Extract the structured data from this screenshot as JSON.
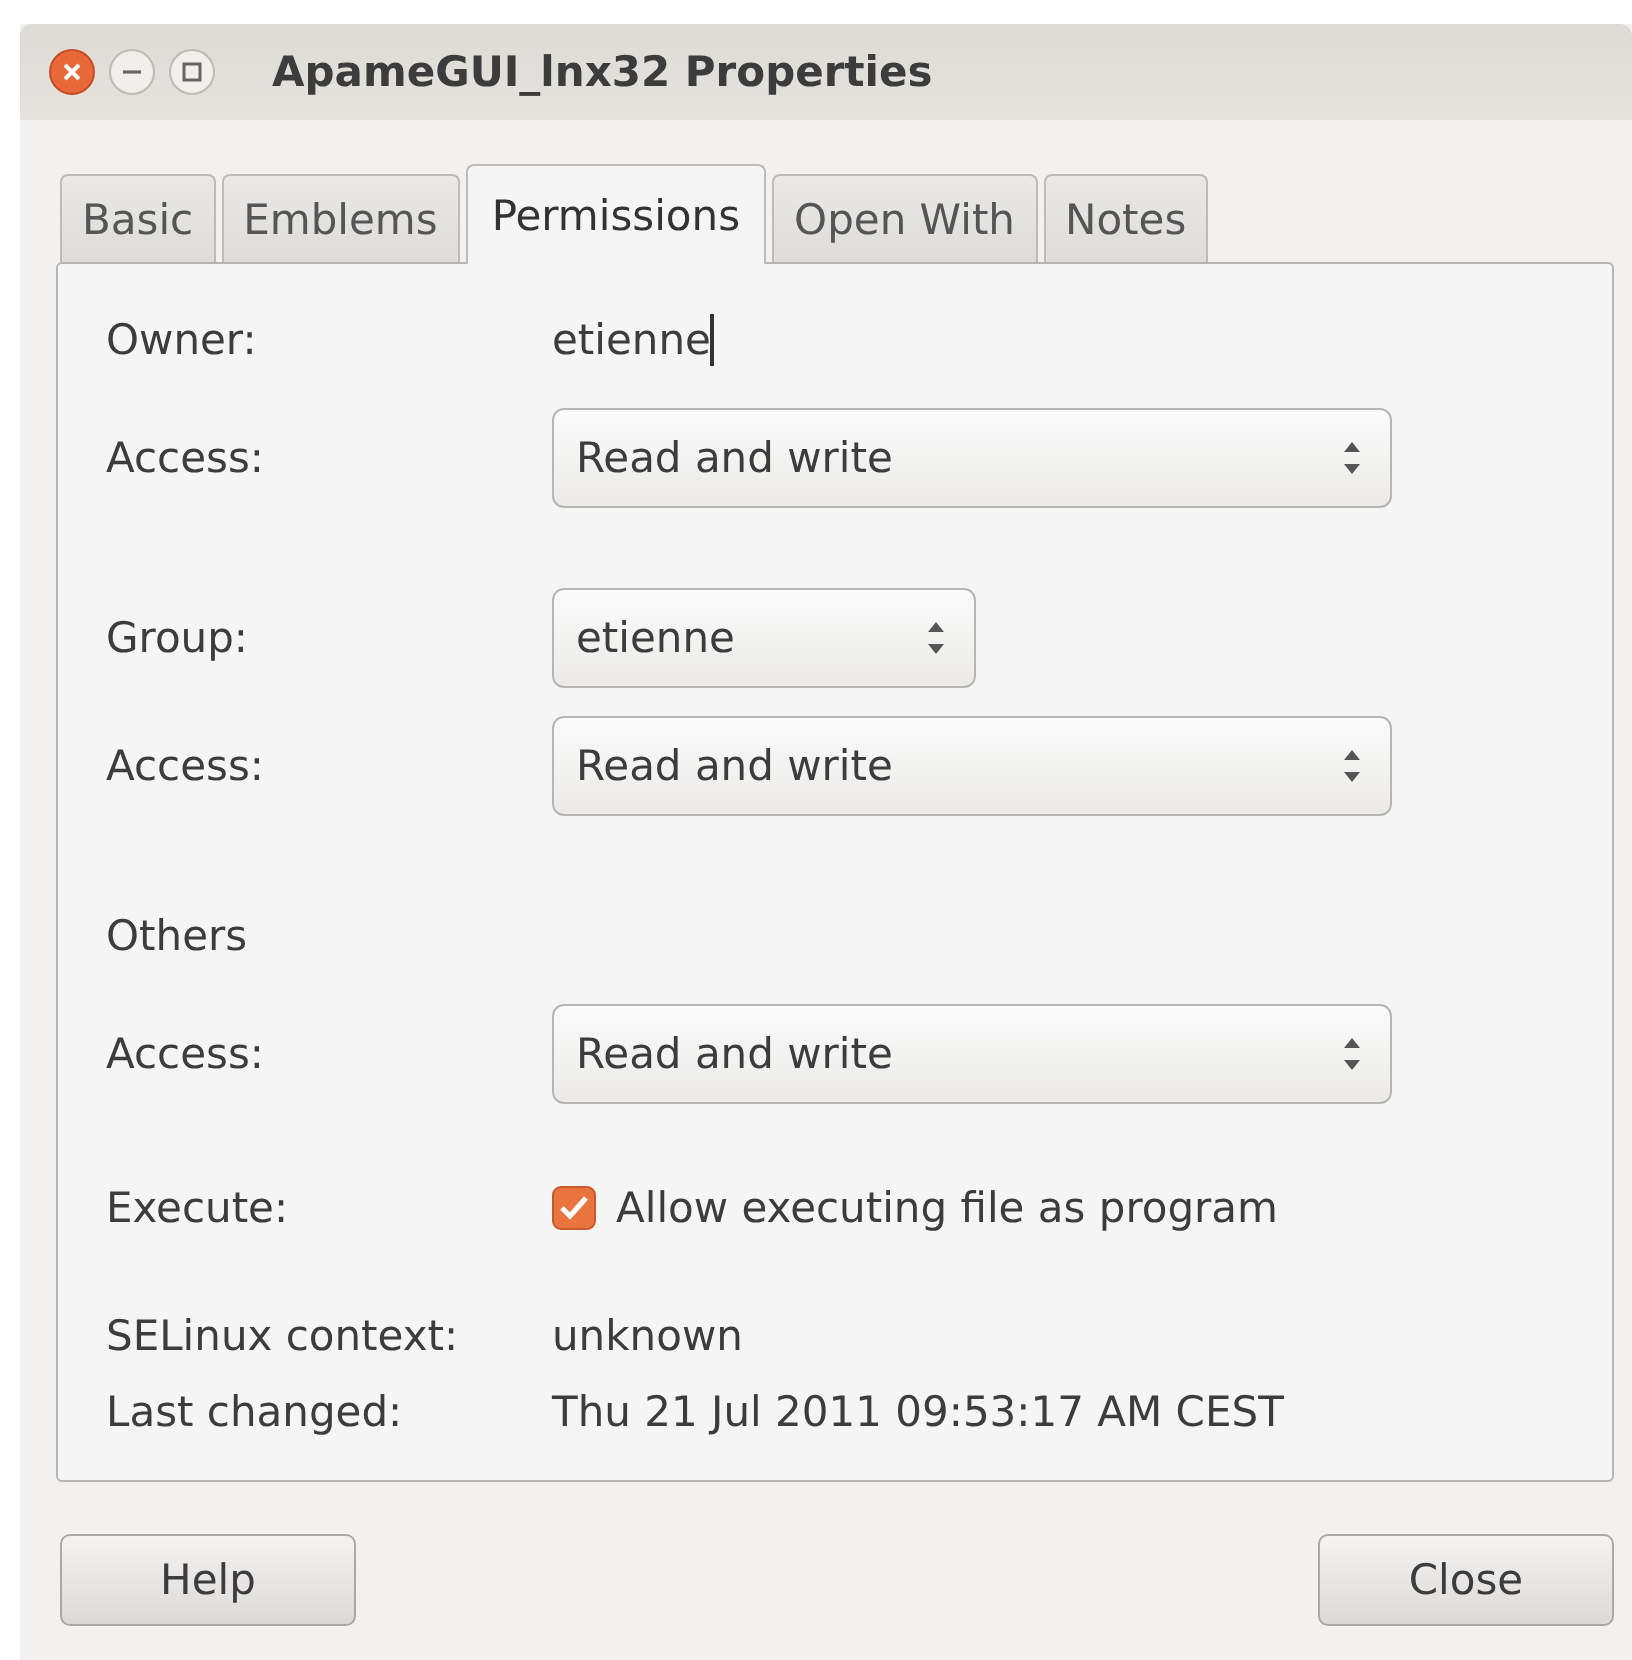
{
  "window": {
    "title": "ApameGUI_lnx32 Properties"
  },
  "tabs": [
    {
      "label": "Basic",
      "selected": false
    },
    {
      "label": "Emblems",
      "selected": false
    },
    {
      "label": "Permissions",
      "selected": true
    },
    {
      "label": "Open With",
      "selected": false
    },
    {
      "label": "Notes",
      "selected": false
    }
  ],
  "sections": [
    {
      "rows": [
        {
          "kind": "entry",
          "label": "Owner:",
          "value": "etienne",
          "focused": true
        },
        {
          "kind": "dropdown",
          "label": "Access:",
          "value": "Read and write",
          "compact": false
        }
      ]
    },
    {
      "rows": [
        {
          "kind": "dropdown",
          "label": "Group:",
          "value": "etienne",
          "compact": true
        },
        {
          "kind": "dropdown",
          "label": "Access:",
          "value": "Read and write",
          "compact": false
        }
      ]
    },
    {
      "rows": [
        {
          "kind": "heading",
          "label": "Others"
        },
        {
          "kind": "dropdown",
          "label": "Access:",
          "value": "Read and write",
          "compact": false
        }
      ]
    },
    {
      "rows": [
        {
          "kind": "check",
          "label": "Execute:",
          "value": "Allow executing file as program",
          "checked": true
        }
      ]
    },
    {
      "rows": [
        {
          "kind": "info",
          "label": "SELinux context:",
          "value": "unknown"
        },
        {
          "kind": "info",
          "label": "Last changed:",
          "value": "Thu 21 Jul 2011 09:53:17 AM CEST"
        }
      ]
    }
  ],
  "buttons": [
    {
      "label": "Help"
    },
    {
      "label": "Close"
    }
  ]
}
